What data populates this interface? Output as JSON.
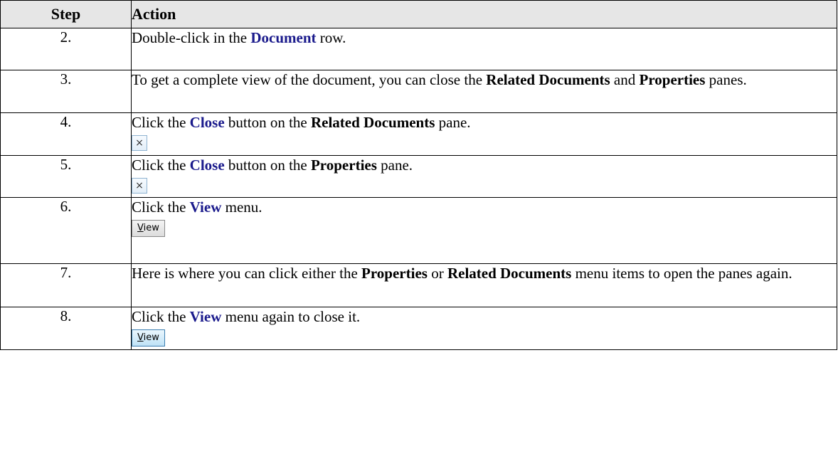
{
  "table": {
    "headers": {
      "step": "Step",
      "action": "Action"
    },
    "rows": [
      {
        "step": "2.",
        "text": {
          "a": "Double-click in the ",
          "b": "Document",
          "c": " row."
        }
      },
      {
        "step": "3.",
        "text": {
          "a": "To get a complete view of the document, you can close the ",
          "b": "Related Documents",
          "c": " and ",
          "d": "Properties",
          "e": " panes."
        }
      },
      {
        "step": "4.",
        "text": {
          "a": "Click the ",
          "b": "Close",
          "c": " button on the ",
          "d": "Related Documents",
          "e": " pane."
        },
        "icon": "close-icon",
        "icon_glyph": "×"
      },
      {
        "step": "5.",
        "text": {
          "a": "Click the ",
          "b": "Close",
          "c": " button on the ",
          "d": "Properties",
          "e": " pane."
        },
        "icon": "close-icon",
        "icon_glyph": "×"
      },
      {
        "step": "6.",
        "text": {
          "a": "Click the ",
          "b": "View",
          "c": " menu."
        },
        "button": {
          "ul": "V",
          "rest": "iew"
        }
      },
      {
        "step": "7.",
        "text": {
          "a": "Here is where you can click either the ",
          "b": "Properties",
          "c": " or ",
          "d": "Related Documents",
          "e": " menu items to open the panes again."
        }
      },
      {
        "step": "8.",
        "text": {
          "a": "Click the ",
          "b": "View",
          "c": " menu again to close it."
        },
        "button": {
          "ul": "V",
          "rest": "iew"
        }
      }
    ]
  },
  "colors": {
    "header_bg": "#e6e6e6",
    "reference_text": "#1a1a8c"
  }
}
